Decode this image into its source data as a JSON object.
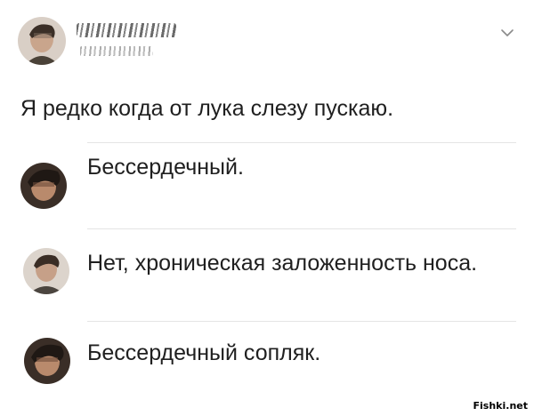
{
  "post": {
    "author_name": "",
    "author_handle": "",
    "text": "Я редко когда от лука слезу пускаю."
  },
  "replies": [
    {
      "text": "Бессердечный."
    },
    {
      "text": "Нет, хроническая заложенность носа."
    },
    {
      "text": "Бессердечный сопляк."
    }
  ],
  "watermark": "Fishki.net",
  "icons": {
    "avatar": "avatar-photo",
    "menu": "chevron-down-icon"
  },
  "colors": {
    "text": "#1f1f1f",
    "divider": "#e4e4e4",
    "chevron": "#8a8a8a"
  }
}
